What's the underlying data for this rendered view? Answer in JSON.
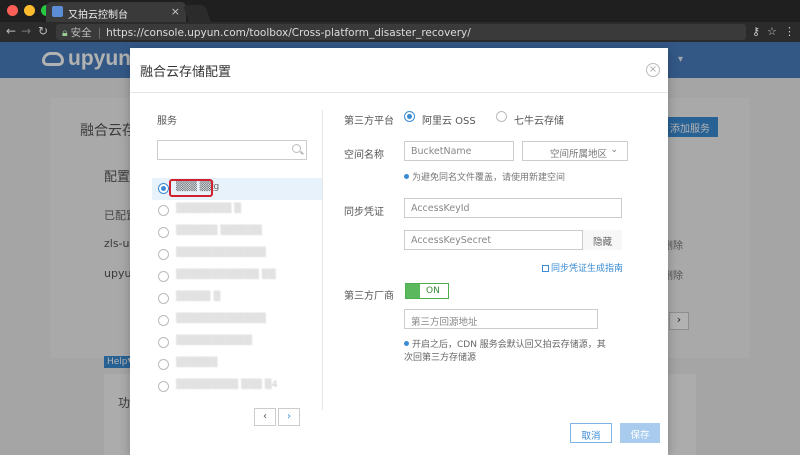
{
  "browser": {
    "tab_title": "又拍云控制台",
    "url_secure_label": "安全",
    "url_separator": "|",
    "url": "https://console.upyun.com/toolbox/Cross-platform_disaster_recovery/"
  },
  "page": {
    "logo_text": "upyun",
    "bg_title": "融合云存储",
    "bg_add_button": "添加服务",
    "bg_section": "配置列",
    "bg_subsection": "已配置",
    "bg_rows": [
      "zls-upy",
      "upyun-"
    ],
    "bg_delete": "删除",
    "help_tag": "Help▼",
    "bg_func": "功"
  },
  "dialog": {
    "title": "融合云存储配置",
    "services": {
      "label": "服务",
      "items": [
        "▒▒▒ ▒▒g",
        "▒▒▒▒▒▒▒▒ ▒",
        "▒▒▒▒▒▒ ▒▒▒▒▒▒",
        "▒▒▒▒▒▒▒▒▒▒▒▒▒",
        "▒▒▒▒▒▒▒▒▒▒▒▒ ▒▒",
        "▒▒▒▒▒ ▒",
        "▒▒▒▒▒▒▒▒▒▒▒▒▒",
        "▒▒▒▒▒▒▒▒▒▒▒",
        "▒▒▒▒▒▒",
        "▒▒▒▒▒▒▒▒▒ ▒▒▒ ▒4"
      ],
      "pager_prev": "‹",
      "pager_next": "›"
    },
    "form": {
      "platform_label": "第三方平台",
      "platform_options": [
        "阿里云 OSS",
        "七牛云存储"
      ],
      "space_label": "空间名称",
      "bucket_placeholder": "BucketName",
      "region_placeholder": "空间所属地区",
      "space_hint": "为避免同名文件覆盖，请使用新建空间",
      "credential_label": "同步凭证",
      "access_key_id_placeholder": "AccessKeyId",
      "access_key_secret_placeholder": "AccessKeySecret",
      "hide_button": "隐藏",
      "guide_link": "同步凭证生成指南",
      "vendor_label": "第三方厂商",
      "toggle_text": "ON",
      "origin_placeholder": "第三方回源地址",
      "desc_line1": "开启之后，CDN 服务会默认回又拍云存储源，其",
      "desc_line2": "次回第三方存储源"
    },
    "buttons": {
      "cancel": "取消",
      "save": "保存"
    }
  },
  "colors": {
    "accent": "#3a8bd4",
    "topnav": "#4a7fc1",
    "highlight": "#d0212f",
    "toggle_on": "#5cb85c"
  }
}
